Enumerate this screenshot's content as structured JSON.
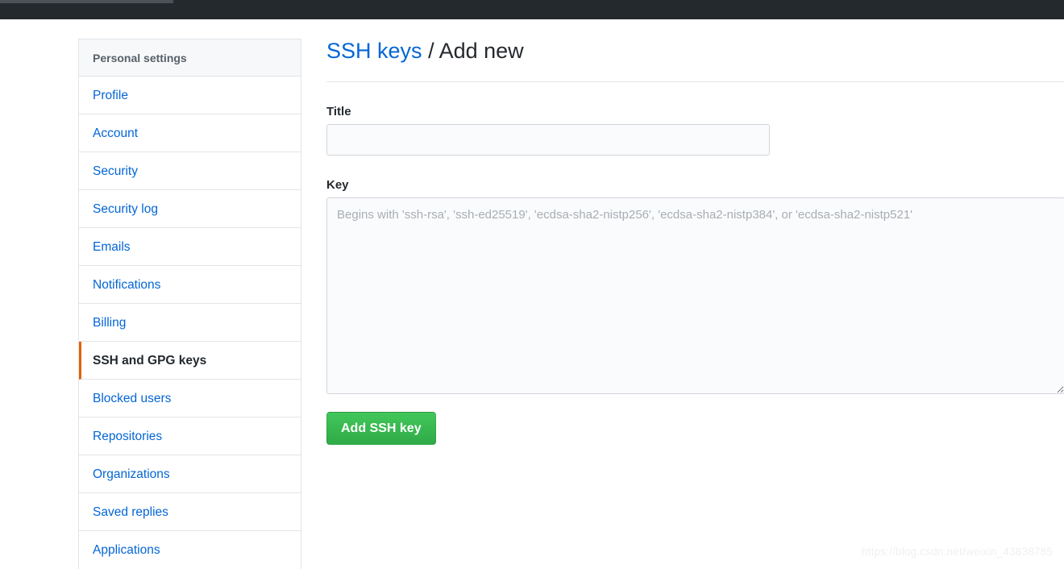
{
  "window": {
    "topbar_color": "#24292e",
    "scrollbar_thumb_color": "#4a5157"
  },
  "sidebar": {
    "header": "Personal settings",
    "selected": "SSH and GPG keys",
    "accent_color": "#e36209",
    "link_color": "#0366d6",
    "items": [
      {
        "label": "Profile",
        "selected": false
      },
      {
        "label": "Account",
        "selected": false
      },
      {
        "label": "Security",
        "selected": false
      },
      {
        "label": "Security log",
        "selected": false
      },
      {
        "label": "Emails",
        "selected": false
      },
      {
        "label": "Notifications",
        "selected": false
      },
      {
        "label": "Billing",
        "selected": false
      },
      {
        "label": "SSH and GPG keys",
        "selected": true
      },
      {
        "label": "Blocked users",
        "selected": false
      },
      {
        "label": "Repositories",
        "selected": false
      },
      {
        "label": "Organizations",
        "selected": false
      },
      {
        "label": "Saved replies",
        "selected": false
      },
      {
        "label": "Applications",
        "selected": false
      }
    ]
  },
  "main": {
    "heading": {
      "link_text": "SSH keys",
      "separator": "/",
      "current": "Add new"
    },
    "title_field": {
      "label": "Title",
      "value": "",
      "placeholder": ""
    },
    "key_field": {
      "label": "Key",
      "value": "",
      "placeholder": "Begins with 'ssh-rsa', 'ssh-ed25519', 'ecdsa-sha2-nistp256', 'ecdsa-sha2-nistp384', or 'ecdsa-sha2-nistp521'"
    },
    "submit_button": {
      "label": "Add SSH key",
      "color": "#2faa47"
    }
  },
  "watermark": {
    "text": "https://blog.csdn.net/weixin_43838785"
  }
}
